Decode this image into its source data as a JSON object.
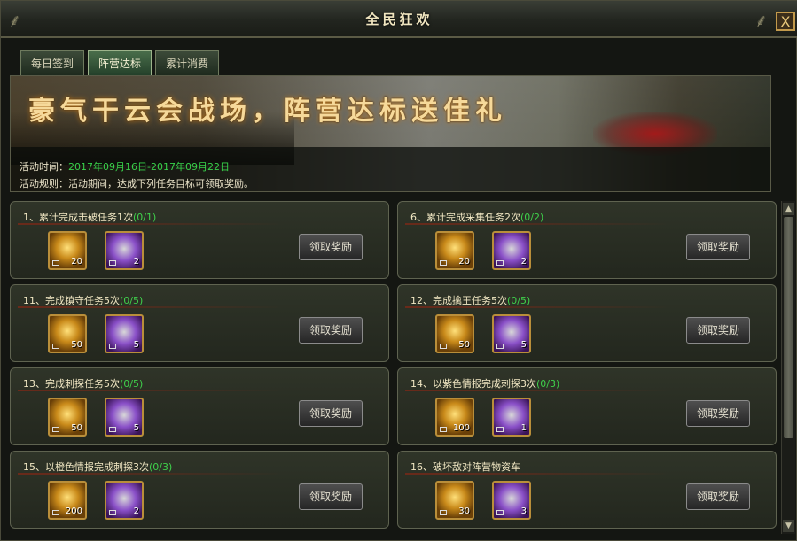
{
  "window": {
    "title": "全民狂欢",
    "close_label": "X"
  },
  "tabs": [
    {
      "label": "每日签到",
      "active": false
    },
    {
      "label": "阵营达标",
      "active": true
    },
    {
      "label": "累计消费",
      "active": false
    }
  ],
  "banner": {
    "headline": "豪气干云会战场，阵营达标送佳礼",
    "time_label": "活动时间：",
    "time_value": "2017年09月16日-2017年09月22日",
    "rule_text": "活动规则：活动期间，达成下列任务目标可领取奖励。"
  },
  "tasks": [
    {
      "title": "1、累计完成击破任务1次",
      "progress": "(0/1)",
      "gold": "20",
      "item": "2",
      "button": "领取奖励"
    },
    {
      "title": "6、累计完成采集任务2次",
      "progress": "(0/2)",
      "gold": "20",
      "item": "2",
      "button": "领取奖励"
    },
    {
      "title": "11、完成镇守任务5次",
      "progress": "(0/5)",
      "gold": "50",
      "item": "5",
      "button": "领取奖励"
    },
    {
      "title": "12、完成擒王任务5次",
      "progress": "(0/5)",
      "gold": "50",
      "item": "5",
      "button": "领取奖励"
    },
    {
      "title": "13、完成刺探任务5次",
      "progress": "(0/5)",
      "gold": "50",
      "item": "5",
      "button": "领取奖励"
    },
    {
      "title": "14、以紫色情报完成刺探3次",
      "progress": "(0/3)",
      "gold": "100",
      "item": "1",
      "button": "领取奖励"
    },
    {
      "title": "15、以橙色情报完成刺探3次",
      "progress": "(0/3)",
      "gold": "200",
      "item": "2",
      "button": "领取奖励"
    },
    {
      "title": "16、破坏敌对阵营物资车",
      "progress": "",
      "gold": "30",
      "item": "3",
      "button": "领取奖励"
    }
  ],
  "icons": {
    "gold": "gold-ingot-icon",
    "item": "scroll-token-icon"
  },
  "colors": {
    "progress": "#3fd04b",
    "time": "#38d04a",
    "title": "#f1e6c0"
  }
}
